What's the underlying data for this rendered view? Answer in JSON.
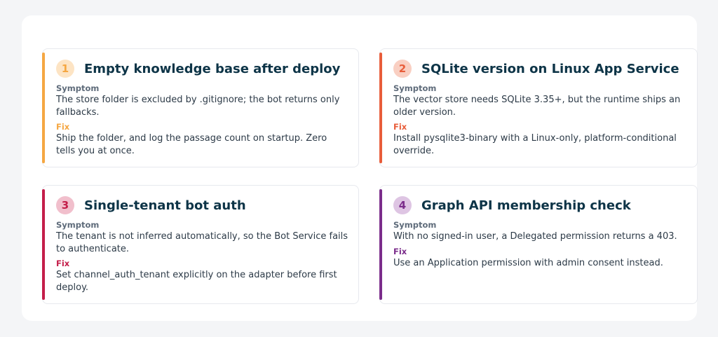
{
  "labels": {
    "symptom": "Symptom",
    "fix": "Fix"
  },
  "colors": {
    "amber": "#f5a742",
    "orange": "#e85d3a",
    "crimson": "#c41e4a",
    "purple": "#7b2d8b",
    "title": "#0d3447"
  },
  "cards": [
    {
      "number": "1",
      "title": "Empty knowledge base after deploy",
      "symptom": "The store folder is excluded by .gitignore; the bot returns only fallbacks.",
      "fix": "Ship the folder, and log the passage count on startup. Zero tells you at once.",
      "accent": "#f5a742",
      "badge_bg": "#fde4c4"
    },
    {
      "number": "2",
      "title": "SQLite version on Linux App Service",
      "symptom": "The vector store needs SQLite 3.35+, but the runtime ships an older version.",
      "fix": "Install pysqlite3-binary with a Linux-only, platform-conditional override.",
      "accent": "#e85d3a",
      "badge_bg": "#f9cfc2"
    },
    {
      "number": "3",
      "title": "Single-tenant bot auth",
      "symptom": "The tenant is not inferred automatically, so the Bot Service fails to authenticate.",
      "fix": "Set channel_auth_tenant explicitly on the adapter before first deploy.",
      "accent": "#c41e4a",
      "badge_bg": "#f1bfcc"
    },
    {
      "number": "4",
      "title": "Graph API membership check",
      "symptom": "With no signed-in user, a Delegated permission returns a 403.",
      "fix": "Use an Application permission with admin consent instead.",
      "accent": "#7b2d8b",
      "badge_bg": "#dec5e3"
    }
  ]
}
